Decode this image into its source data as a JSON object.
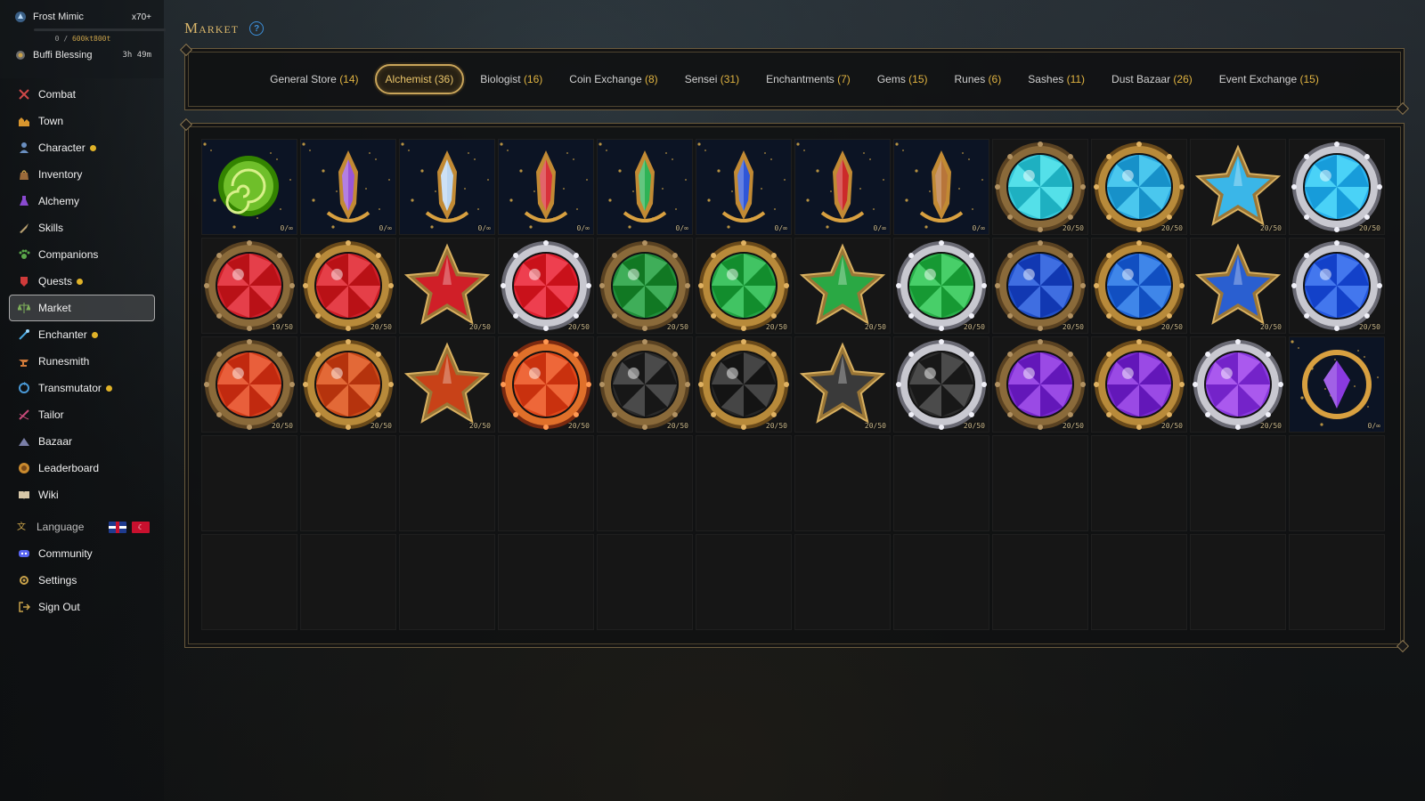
{
  "pet": {
    "name": "Frost Mimic",
    "count": "x70+",
    "xp_current": "0",
    "xp_max": "600kt800t",
    "buff_name": "Buffi Blessing",
    "buff_timer": "3h 49m"
  },
  "nav": [
    {
      "label": "Combat",
      "icon": "swords-icon",
      "dot": false
    },
    {
      "label": "Town",
      "icon": "town-icon",
      "dot": false
    },
    {
      "label": "Character",
      "icon": "character-icon",
      "dot": true
    },
    {
      "label": "Inventory",
      "icon": "bag-icon",
      "dot": false
    },
    {
      "label": "Alchemy",
      "icon": "potion-icon",
      "dot": false
    },
    {
      "label": "Skills",
      "icon": "skills-icon",
      "dot": false
    },
    {
      "label": "Companions",
      "icon": "paw-icon",
      "dot": false
    },
    {
      "label": "Quests",
      "icon": "quest-icon",
      "dot": true
    },
    {
      "label": "Market",
      "icon": "scale-icon",
      "dot": false,
      "active": true
    },
    {
      "label": "Enchanter",
      "icon": "wand-icon",
      "dot": true
    },
    {
      "label": "Runesmith",
      "icon": "anvil-icon",
      "dot": false
    },
    {
      "label": "Transmutator",
      "icon": "cycle-icon",
      "dot": true
    },
    {
      "label": "Tailor",
      "icon": "needle-icon",
      "dot": false
    },
    {
      "label": "Bazaar",
      "icon": "tent-icon",
      "dot": false
    },
    {
      "label": "Leaderboard",
      "icon": "trophy-icon",
      "dot": false
    },
    {
      "label": "Wiki",
      "icon": "book-icon",
      "dot": false
    }
  ],
  "footer_nav": [
    {
      "label": "Language",
      "icon": "language-icon"
    },
    {
      "label": "Community",
      "icon": "discord-icon"
    },
    {
      "label": "Settings",
      "icon": "gear-icon"
    },
    {
      "label": "Sign Out",
      "icon": "sign-out-icon"
    }
  ],
  "market": {
    "title": "Market",
    "tabs": [
      {
        "label": "General Store",
        "count": "(14)"
      },
      {
        "label": "Alchemist",
        "count": "(36)",
        "active": true
      },
      {
        "label": "Biologist",
        "count": "(16)"
      },
      {
        "label": "Coin Exchange",
        "count": "(8)"
      },
      {
        "label": "Sensei",
        "count": "(31)"
      },
      {
        "label": "Enchantments",
        "count": "(7)"
      },
      {
        "label": "Gems",
        "count": "(15)"
      },
      {
        "label": "Runes",
        "count": "(6)"
      },
      {
        "label": "Sashes",
        "count": "(11)"
      },
      {
        "label": "Dust Bazaar",
        "count": "(26)"
      },
      {
        "label": "Event Exchange",
        "count": "(15)"
      }
    ],
    "items": [
      {
        "kind": "swirl",
        "color": "#6fbf2a",
        "qty": "0/∞"
      },
      {
        "kind": "crystal",
        "color": "#9a56d8",
        "qty": "0/∞"
      },
      {
        "kind": "crystal",
        "color": "#bcd6f0",
        "qty": "0/∞"
      },
      {
        "kind": "crystal",
        "color": "#d8323a",
        "qty": "0/∞"
      },
      {
        "kind": "crystal",
        "color": "#2fb356",
        "qty": "0/∞"
      },
      {
        "kind": "crystal",
        "color": "#2f56d8",
        "qty": "0/∞"
      },
      {
        "kind": "crystal",
        "color": "#cc2a2a",
        "qty": "0/∞"
      },
      {
        "kind": "crystal",
        "color": "#b8753a",
        "qty": "0/∞"
      },
      {
        "kind": "gem-bronze",
        "color": "#35c6d8",
        "qty": "20/50"
      },
      {
        "kind": "gem-gold",
        "color": "#2aa8e0",
        "qty": "20/50"
      },
      {
        "kind": "star",
        "color": "#3ab6e8",
        "qty": "20/50"
      },
      {
        "kind": "gem-silver",
        "color": "#2ab3f0",
        "qty": "20/50"
      },
      {
        "kind": "gem-bronze",
        "color": "#d0202a",
        "qty": "19/50"
      },
      {
        "kind": "gem-gold",
        "color": "#d01f28",
        "qty": "20/50"
      },
      {
        "kind": "star",
        "color": "#d01f28",
        "qty": "20/50"
      },
      {
        "kind": "gem-silver",
        "color": "#e02030",
        "qty": "20/50"
      },
      {
        "kind": "gem-bronze",
        "color": "#1f8f3a",
        "qty": "20/50"
      },
      {
        "kind": "gem-gold",
        "color": "#22a444",
        "qty": "20/50"
      },
      {
        "kind": "star",
        "color": "#2aa844",
        "qty": "20/50"
      },
      {
        "kind": "gem-silver",
        "color": "#29b04a",
        "qty": "20/50"
      },
      {
        "kind": "gem-bronze",
        "color": "#1f4fc8",
        "qty": "20/50"
      },
      {
        "kind": "gem-gold",
        "color": "#2066d8",
        "qty": "20/50"
      },
      {
        "kind": "star",
        "color": "#2a5fd0",
        "qty": "20/50"
      },
      {
        "kind": "gem-silver",
        "color": "#2458e0",
        "qty": "20/50"
      },
      {
        "kind": "gem-bronze",
        "color": "#d8401c",
        "qty": "20/50"
      },
      {
        "kind": "gem-gold",
        "color": "#cc4a18",
        "qty": "20/50"
      },
      {
        "kind": "star",
        "color": "#c84218",
        "qty": "20/50"
      },
      {
        "kind": "gem-fire",
        "color": "#e0481a",
        "qty": "20/50"
      },
      {
        "kind": "gem-bronze",
        "color": "#2a2a2a",
        "qty": "20/50"
      },
      {
        "kind": "gem-gold",
        "color": "#262626",
        "qty": "20/50"
      },
      {
        "kind": "star",
        "color": "#3a3a3a",
        "qty": "20/50"
      },
      {
        "kind": "gem-silver",
        "color": "#2c2c2c",
        "qty": "20/50"
      },
      {
        "kind": "gem-bronze",
        "color": "#7a2ad0",
        "qty": "20/50"
      },
      {
        "kind": "gem-gold",
        "color": "#7a2ad0",
        "qty": "20/50"
      },
      {
        "kind": "gem-silver",
        "color": "#8a3ae0",
        "qty": "20/50"
      },
      {
        "kind": "amulet",
        "color": "#8a3ae0",
        "qty": "0/∞"
      }
    ],
    "empty_slots": 24
  }
}
